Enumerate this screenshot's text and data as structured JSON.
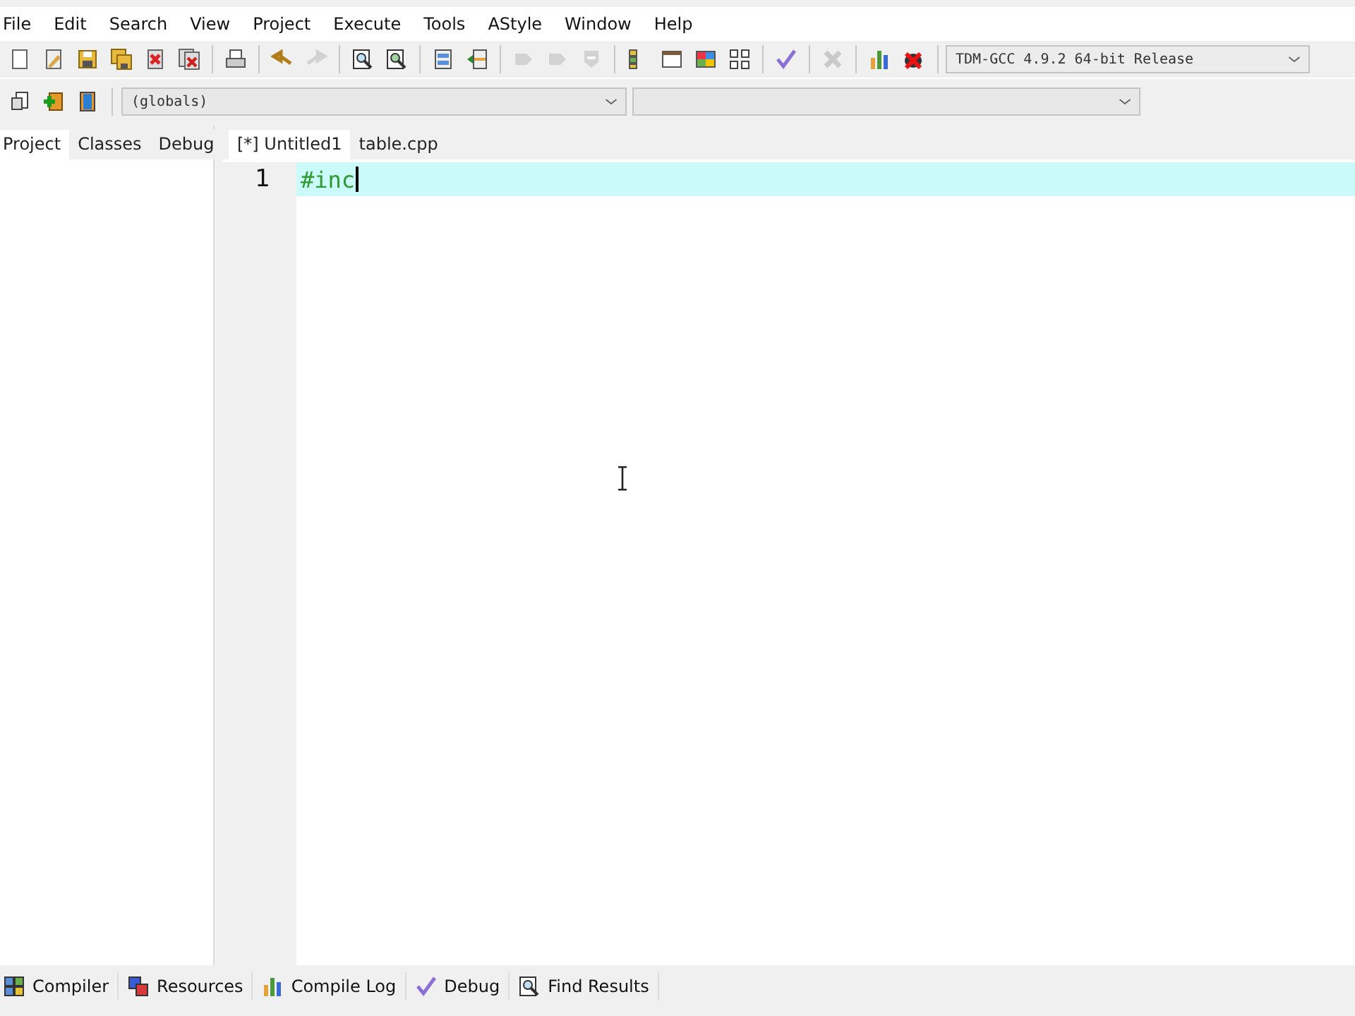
{
  "menu_bar": [
    "File",
    "Edit",
    "Search",
    "View",
    "Project",
    "Execute",
    "Tools",
    "AStyle",
    "Window",
    "Help"
  ],
  "toolbar": {
    "groups": [
      [
        {
          "disabled": false
        },
        {
          "disabled": false
        },
        {
          "disabled": false
        },
        {
          "disabled": false
        },
        {
          "disabled": false
        },
        {
          "disabled": false
        }
      ],
      [
        {
          "disabled": false
        }
      ],
      [
        {
          "disabled": false
        },
        {
          "disabled": true
        }
      ],
      [
        {
          "disabled": false
        },
        {
          "disabled": false
        }
      ],
      [
        {
          "disabled": false
        },
        {
          "disabled": false
        }
      ],
      [
        {
          "disabled": true
        },
        {
          "disabled": true
        },
        {
          "disabled": true
        }
      ],
      [
        {
          "disabled": false
        },
        {
          "disabled": false
        },
        {
          "disabled": false
        },
        {
          "disabled": false
        }
      ],
      [
        {
          "disabled": false
        }
      ],
      [
        {
          "disabled": true
        }
      ],
      [
        {
          "disabled": false
        },
        {
          "disabled": false
        }
      ]
    ],
    "compiler_select": "TDM-GCC 4.9.2 64-bit Release"
  },
  "class_toolbar": {
    "buttons": [
      {
        "disabled": false
      },
      {
        "disabled": false
      },
      {
        "disabled": false
      }
    ],
    "scope_select": "(globals)"
  },
  "side_panel": {
    "tabs": [
      {
        "label": "Project",
        "selected": true
      },
      {
        "label": "Classes",
        "selected": false
      },
      {
        "label": "Debug",
        "selected": false
      }
    ]
  },
  "editor": {
    "tabs": [
      {
        "label": "[*] Untitled1",
        "selected": true
      },
      {
        "label": "table.cpp",
        "selected": false
      }
    ],
    "lines": [
      {
        "number": "1",
        "code": "#inc",
        "current": true
      }
    ]
  },
  "bottom_tabs": [
    {
      "label": "Compiler"
    },
    {
      "label": "Resources"
    },
    {
      "label": "Compile Log"
    },
    {
      "label": "Debug"
    },
    {
      "label": "Find Results"
    }
  ]
}
